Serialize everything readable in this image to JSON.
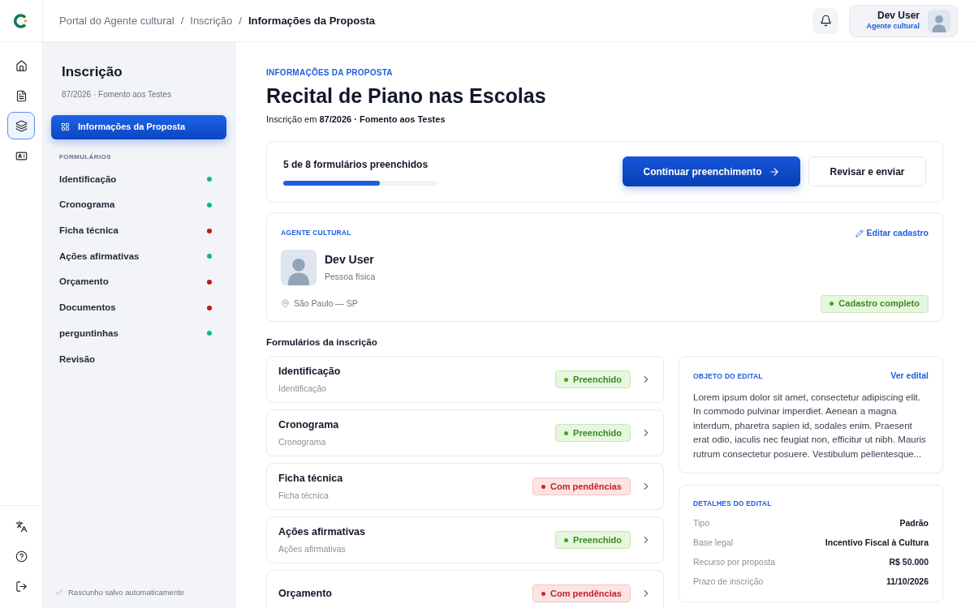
{
  "breadcrumb": [
    {
      "label": "Portal do Agente cultural",
      "current": false
    },
    {
      "label": "Inscrição",
      "current": false
    },
    {
      "label": "Informações da Proposta",
      "current": true
    }
  ],
  "breadcrumb_separator": "/",
  "user": {
    "name": "Dev User",
    "role": "Agente cultural"
  },
  "rail": {
    "top": [
      {
        "selected": false
      },
      {
        "selected": false
      },
      {
        "selected": true
      },
      {
        "selected": false
      }
    ]
  },
  "sidebar": {
    "title": "Inscrição",
    "subtitle": "87/2026 · Fomento aos Testes",
    "active_item": "Informações da Proposta",
    "section": "FORMULÁRIOS",
    "items": [
      {
        "label": "Identificação",
        "color": "#10b981"
      },
      {
        "label": "Cronograma",
        "color": "#10b981"
      },
      {
        "label": "Ficha técnica",
        "color": "#b91c1c"
      },
      {
        "label": "Ações afirmativas",
        "color": "#10b981"
      },
      {
        "label": "Orçamento",
        "color": "#b91c1c"
      },
      {
        "label": "Documentos",
        "color": "#b91c1c"
      },
      {
        "label": "perguntinhas",
        "color": "#10b981"
      },
      {
        "label": "Revisão"
      }
    ],
    "autosave": "Rascunho salvo automaticamente"
  },
  "header": {
    "eyebrow": "INFORMAÇÕES DA PROPOSTA",
    "title": "Recital de Piano nas Escolas",
    "subtitle": "Inscrição em **87/2026 · Fomento aos Testes**"
  },
  "progress": {
    "label": "5 de 8 formulários preenchidos",
    "level": 0.63,
    "primary_button": "Continuar preenchimento",
    "secondary_button": "Revisar e enviar"
  },
  "agent": {
    "eyebrow": "AGENTE CULTURAL",
    "edit_link": "Editar cadastro",
    "name": "Dev User",
    "type": "Pessoa física",
    "location": "São Paulo — SP",
    "status": "Cadastro completo"
  },
  "forms": {
    "title": "Formulários da inscrição",
    "items": [
      {
        "title": "Identificação",
        "subtitle": "Identificação",
        "kind": "done",
        "badge": "Preenchido"
      },
      {
        "title": "Cronograma",
        "subtitle": "Cronograma",
        "kind": "done",
        "badge": "Preenchido"
      },
      {
        "title": "Ficha técnica",
        "subtitle": "Ficha técnica",
        "kind": "pending",
        "badge": "Com pendências"
      },
      {
        "title": "Ações afirmativas",
        "subtitle": "Ações afirmativas",
        "kind": "done",
        "badge": "Preenchido"
      },
      {
        "title": "Orçamento",
        "kind": "pending",
        "badge": "Com pendências"
      }
    ]
  },
  "edital": {
    "eyebrow": "OBJETO DO EDITAL",
    "link": "Ver edital",
    "text": "Lorem ipsum dolor sit amet, consectetur adipiscing elit. In commodo pulvinar imperdiet. Aenean a magna interdum, pharetra sapien id, sodales enim. Praesent erat odio, iaculis nec feugiat non, efficitur ut nibh. Mauris rutrum consectetur posuere. Vestibulum pellentesque..."
  },
  "details": {
    "eyebrow": "DETALHES DO EDITAL",
    "rows": [
      {
        "label": "Tipo",
        "value": "Padrão"
      },
      {
        "label": "Base legal",
        "value": "Incentivo Fiscal à Cultura"
      },
      {
        "label": "Recurso por proposta",
        "value": "R$ 50.000"
      },
      {
        "label": "Prazo de inscrição",
        "value": "11/10/2026"
      }
    ]
  }
}
